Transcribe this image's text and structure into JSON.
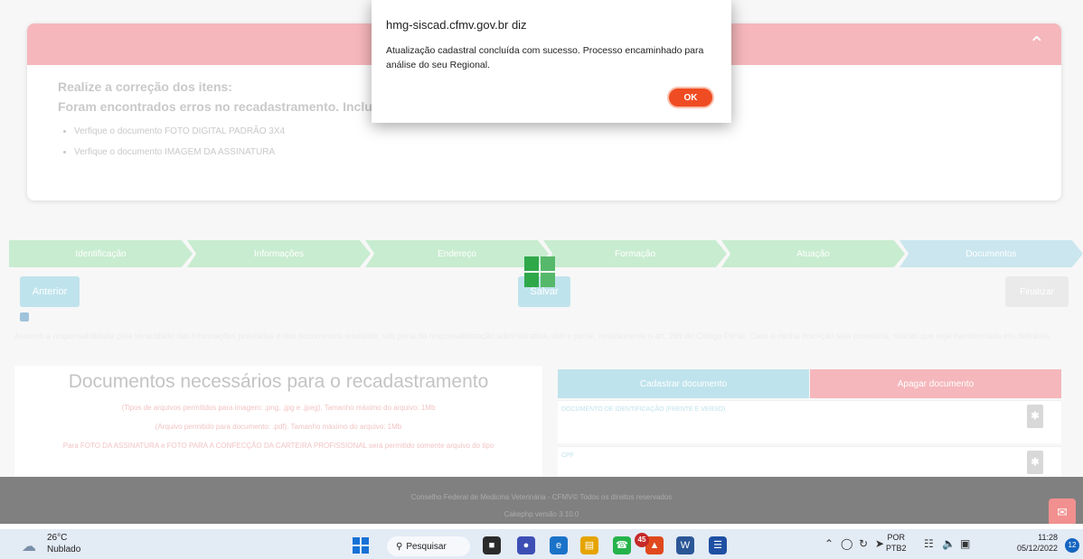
{
  "error_card": {
    "line1": "Realize a correção dos itens:",
    "line2": "Foram encontrados erros no recadastramento. Incluir",
    "items": [
      "Verfique o documento FOTO DIGITAL PADRÃO 3X4",
      "Verfique o documento IMAGEM DA ASSINATURA"
    ]
  },
  "steps": [
    "Identificação",
    "Informações",
    "Endereço",
    "Formação",
    "Atuação",
    "Documentos"
  ],
  "buttons": {
    "anterior": "Anterior",
    "salvar": "Salvar",
    "finalizar": "Finalizar"
  },
  "agree_text": "Assumo a responsabilidade pela veracidade das informações prestadas e dos documentos enviados, sob pena de responsabilização administrativa, civil e penal, notadamente o art. 299 do Código Penal. Caso a minha inscrição seja provisória, solicito que seja transformada em definitiva.",
  "docs": {
    "title": "Documentos necessários para o recadastramento",
    "notes": [
      "(Tipos de arquivos permitidos para imagem: .png, .jpg e .jpeg). Tamanho máximo do arquivo: 1Mb",
      "(Arquivo permitido para documento: .pdf). Tamanho máximo do arquivo: 1Mb",
      "Para FOTO DA ASSINATURA e FOTO PARA A CONFECÇÃO DA CARTEIRA PROFISSIONAL será permitido somente arquivo do tipo"
    ],
    "cadastrar": "Cadastrar documento",
    "apagar": "Apagar documento",
    "rows": [
      "DOCUMENTO DE IDENTIFICAÇÃO (FRENTE E VERSO)",
      "CPF"
    ]
  },
  "footer": {
    "line1": "Conselho Federal de Medicina Veterinária - CFMV© Todos os direitos reservados",
    "line2": "Cakephp versão 3.10.0"
  },
  "dialog": {
    "title": "hmg-siscad.cfmv.gov.br diz",
    "message": "Atualização cadastral concluída com sucesso. Processo encaminhado para análise do seu Regional.",
    "ok": "OK"
  },
  "taskbar": {
    "temp": "26°C",
    "weather": "Nublado",
    "search": "Pesquisar",
    "whatsapp_badge": "45",
    "lang1": "POR",
    "lang2": "PTB2",
    "time": "11:28",
    "date": "05/12/2022",
    "notifications": "12"
  },
  "colors": {
    "accent": "#f04c23",
    "taskbar": "#e3ebf5",
    "step_green": "#c8ecd0",
    "step_blue": "#cbe6ee"
  }
}
